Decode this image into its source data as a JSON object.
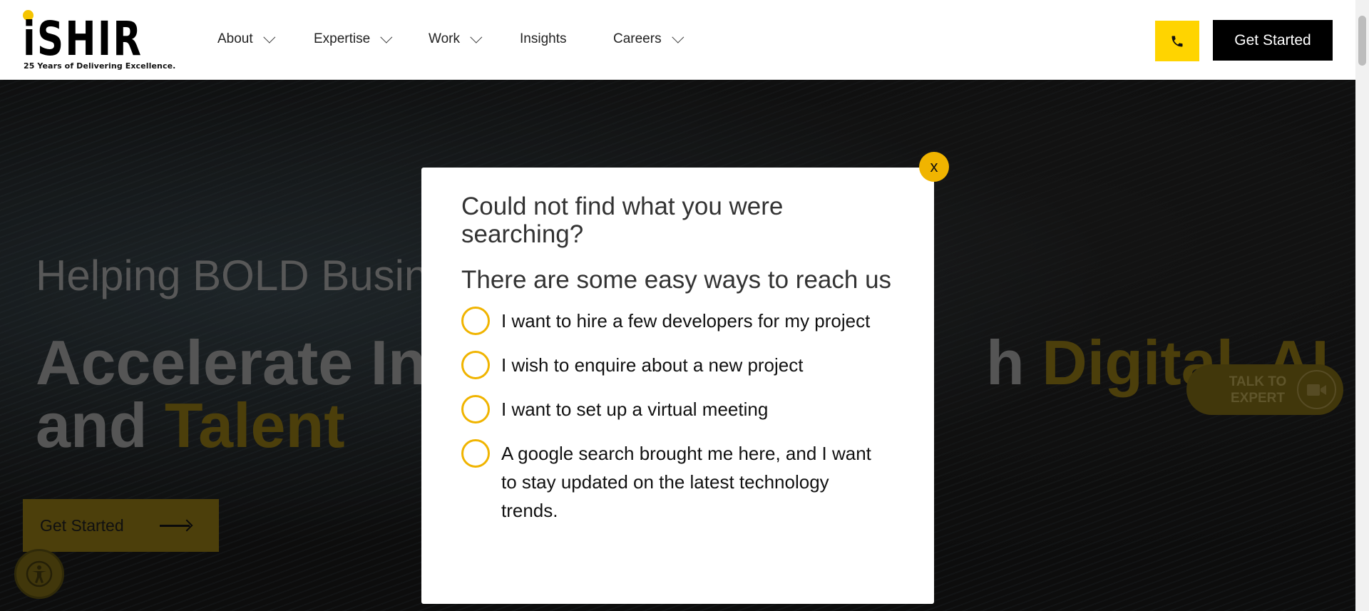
{
  "header": {
    "logo_text": "iSHIR",
    "logo_tagline": "25 Years of Delivering Excellence.",
    "nav": [
      {
        "label": "About",
        "has_dropdown": true
      },
      {
        "label": "Expertise",
        "has_dropdown": true
      },
      {
        "label": "Work",
        "has_dropdown": true
      },
      {
        "label": "Insights",
        "has_dropdown": false
      },
      {
        "label": "Careers",
        "has_dropdown": true
      }
    ],
    "cta_label": "Get Started",
    "phone_icon": "phone-icon"
  },
  "hero": {
    "subtitle": "Helping BOLD Busin",
    "title_part1": "Accelerate In",
    "title_part2_plain": "h ",
    "title_part2_accent": "Digital, AI",
    "title_line2_plain": "and ",
    "title_line2_accent": "Talent",
    "button_label": "Get Started",
    "talk_expert": "TALK TO EXPERT"
  },
  "modal": {
    "close_label": "x",
    "title": "Could not find what you were searching?",
    "subtitle": "There are some easy ways to reach us",
    "options": [
      "I want to hire a few developers for my project",
      "I wish to enquire about a new project",
      "I want to set up a virtual meeting",
      "A google search brought me here, and I want to stay updated on the latest technology trends."
    ]
  },
  "colors": {
    "accent": "#f0b400",
    "brand_yellow": "#ffd400",
    "black": "#000000"
  }
}
